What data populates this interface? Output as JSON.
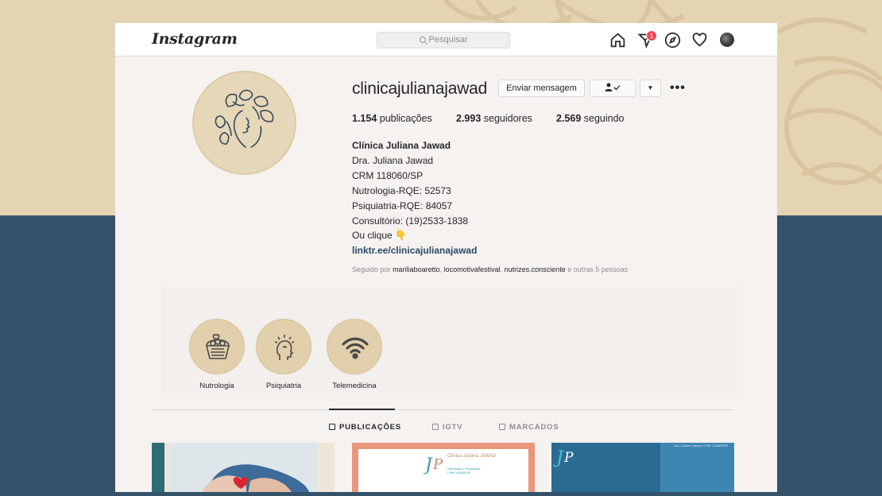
{
  "brand": {
    "logo": "Instagram"
  },
  "search": {
    "placeholder": "Pesquisar"
  },
  "nav": {
    "notification_count": "1"
  },
  "profile": {
    "username": "clinicajulianajawad",
    "message_button": "Enviar mensagem",
    "follow_status_icon": "user-check-icon",
    "dropdown_glyph": "▼",
    "more_glyph": "•••",
    "stats": {
      "posts_count": "1.154",
      "posts_label": "publicações",
      "followers_count": "2.993",
      "followers_label": "seguidores",
      "following_count": "2.569",
      "following_label": "seguindo"
    },
    "bio": {
      "name": "Clínica Juliana Jawad",
      "line1": "Dra. Juliana Jawad",
      "line2": "CRM 118060/SP",
      "line3": "Nutrologia-RQE: 52573",
      "line4": "Psiquiatria-RQE: 84057",
      "line5": "Consultório: (19)2533-1838",
      "line6": "Ou clique 👇",
      "link": "linktr.ee/clinicajulianajawad"
    },
    "followed_by": {
      "prefix": "Seguido por",
      "user1": "mariliaboaretto",
      "user2": "locomotivafestival",
      "user3": "nutrizes.consciente",
      "suffix": "e outras 5 pessoas"
    }
  },
  "highlights": [
    {
      "label": "Nutrologia",
      "icon": "fruit-basket-icon"
    },
    {
      "label": "Psiquiatria",
      "icon": "head-mind-icon"
    },
    {
      "label": "Telemedicina",
      "icon": "wifi-icon"
    }
  ],
  "tabs": [
    {
      "label": "PUBLICAÇÕES",
      "active": true
    },
    {
      "label": "IGTV",
      "active": false
    },
    {
      "label": "MARCADOS",
      "active": false
    }
  ],
  "posts": [
    {
      "caption": ""
    },
    {
      "caption": "Clínica Juliana JAWAD",
      "sub": "Nutrologia e Psiquiatria",
      "crm": "CRM 118060/SP"
    },
    {
      "caption": "Dra. Juliana Jawad | CRM: 118060/SP"
    }
  ],
  "colors": {
    "beige": "#e5d4b4",
    "navy": "#34536a",
    "highlight_circle": "#e2cfab",
    "badge": "#ed4956",
    "link": "#2b4a6a"
  }
}
